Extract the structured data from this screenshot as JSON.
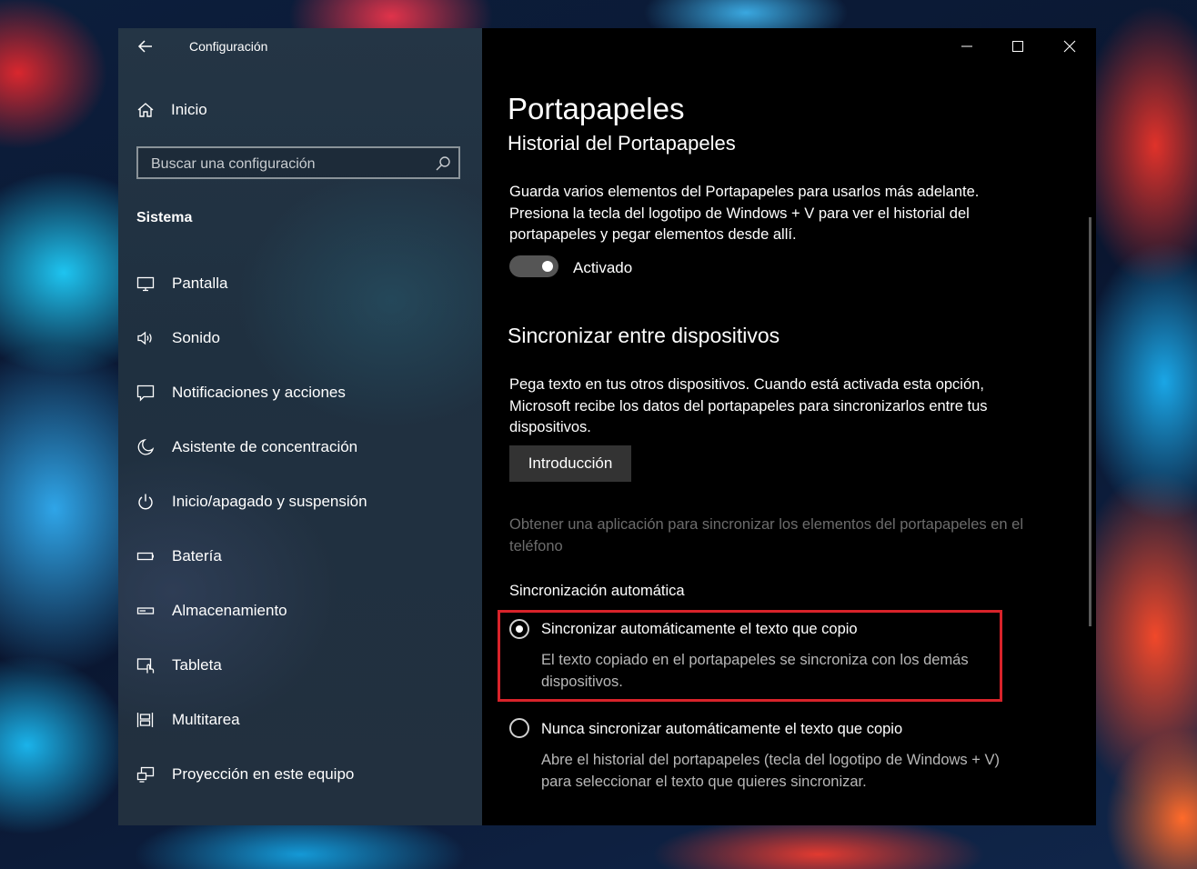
{
  "sidebar": {
    "app_title": "Configuración",
    "home_label": "Inicio",
    "search_placeholder": "Buscar una configuración",
    "section_label": "Sistema",
    "items": [
      {
        "label": "Pantalla",
        "icon": "display-icon"
      },
      {
        "label": "Sonido",
        "icon": "speaker-icon"
      },
      {
        "label": "Notificaciones y acciones",
        "icon": "notification-icon"
      },
      {
        "label": "Asistente de concentración",
        "icon": "moon-icon"
      },
      {
        "label": "Inicio/apagado y suspensión",
        "icon": "power-icon"
      },
      {
        "label": "Batería",
        "icon": "battery-icon"
      },
      {
        "label": "Almacenamiento",
        "icon": "storage-icon"
      },
      {
        "label": "Tableta",
        "icon": "tablet-icon"
      },
      {
        "label": "Multitarea",
        "icon": "multitask-icon"
      },
      {
        "label": "Proyección en este equipo",
        "icon": "projection-icon"
      }
    ]
  },
  "main": {
    "page_title": "Portapapeles",
    "history_header": "Historial del Portapapeles",
    "history_paragraph": "Guarda varios elementos del Portapapeles para usarlos más adelante. Presiona la tecla del logotipo de Windows + V para ver el historial del portapapeles y pegar elementos desde allí.",
    "toggle_label": "Activado",
    "toggle_state": "on",
    "sync_header": "Sincronizar entre dispositivos",
    "sync_paragraph": "Pega texto en tus otros dispositivos. Cuando está activada esta opción, Microsoft recibe los datos del portapapeles para sincronizarlos entre tus dispositivos.",
    "intro_button": "Introducción",
    "phone_app_link": "Obtener una aplicación para sincronizar los elementos del portapapeles en el teléfono",
    "auto_sync_label": "Sincronización automática",
    "option_auto": {
      "label": "Sincronizar automáticamente el texto que copio",
      "description": "El texto copiado en el portapapeles se sincroniza con los demás dispositivos.",
      "selected": true
    },
    "option_never": {
      "label": "Nunca sincronizar automáticamente el texto que copio",
      "description": "Abre el historial del portapapeles (tecla del logotipo de Windows + V) para seleccionar el texto que quieres sincronizar.",
      "selected": false
    }
  },
  "colors": {
    "highlight_border": "#d8232a",
    "sidebar_bg": "#22303f",
    "main_bg": "#000000",
    "muted_text": "#6c6c6c"
  }
}
